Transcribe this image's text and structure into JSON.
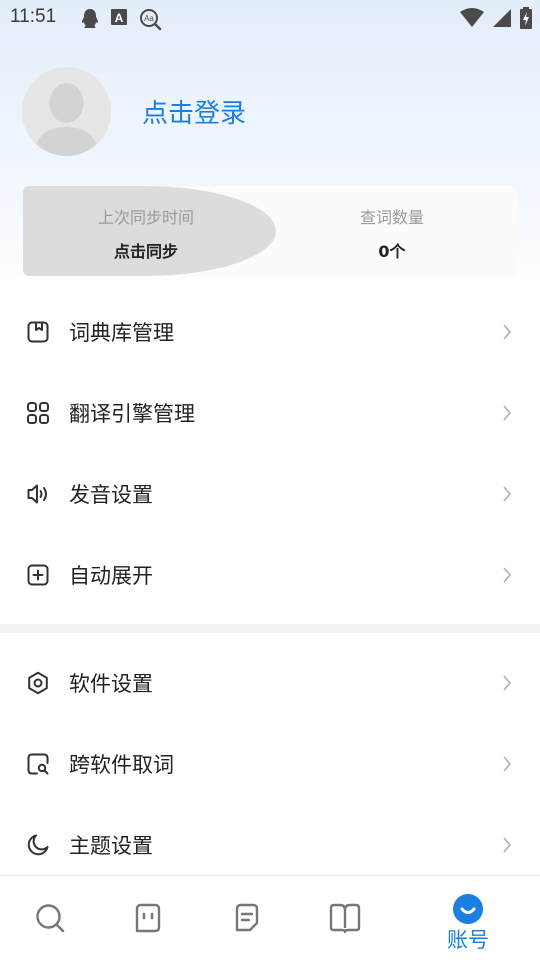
{
  "status_bar": {
    "time": "11:51"
  },
  "profile": {
    "login_label": "点击登录"
  },
  "sync_card": {
    "last_sync_label": "上次同步时间",
    "sync_action": "点击同步",
    "lookup_count_label": "查词数量",
    "lookup_count_value": "0个"
  },
  "menu_group_1": [
    {
      "label": "词典库管理",
      "icon": "bookmark-icon"
    },
    {
      "label": "翻译引擎管理",
      "icon": "grid-icon"
    },
    {
      "label": "发音设置",
      "icon": "speaker-icon"
    },
    {
      "label": "自动展开",
      "icon": "plus-square-icon"
    }
  ],
  "menu_group_2": [
    {
      "label": "软件设置",
      "icon": "hex-settings-icon"
    },
    {
      "label": "跨软件取词",
      "icon": "search-doc-icon"
    },
    {
      "label": "主题设置",
      "icon": "moon-icon"
    }
  ],
  "bottom_nav": {
    "active_label": "账号",
    "items": [
      "search-icon",
      "dictionary-icon",
      "notes-icon",
      "book-icon",
      "account-icon"
    ]
  },
  "colors": {
    "accent": "#1a7fe0",
    "text": "#222222",
    "muted": "#9a9a9a",
    "icon": "#333333"
  }
}
